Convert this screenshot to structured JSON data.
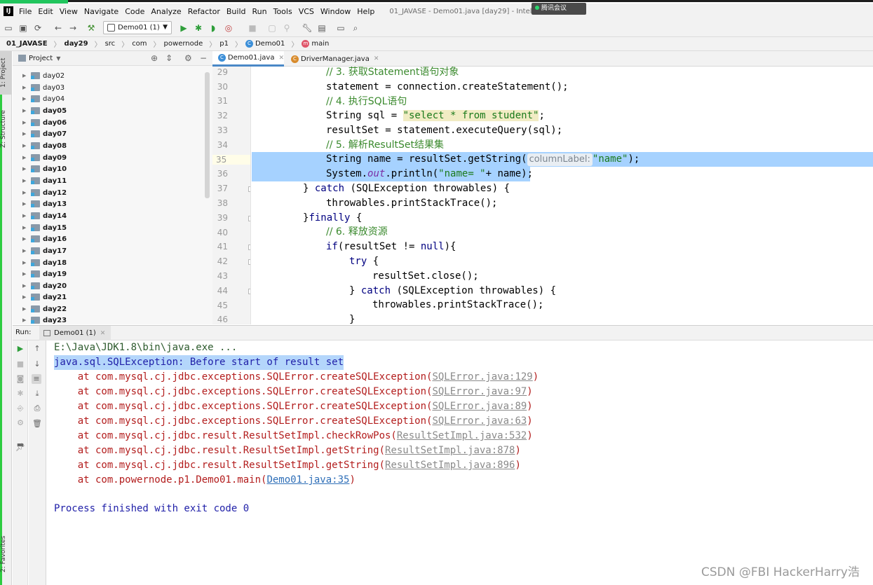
{
  "menubar": {
    "logo": "IJ",
    "items": [
      "File",
      "Edit",
      "View",
      "Navigate",
      "Code",
      "Analyze",
      "Refactor",
      "Build",
      "Run",
      "Tools",
      "VCS",
      "Window",
      "Help"
    ],
    "window_title": "01_JAVASE - Demo01.java [day29] - IntelliJ IDEA",
    "meeting_badge": "腾讯会议"
  },
  "toolbar": {
    "run_config": "Demo01 (1)"
  },
  "breadcrumb": [
    "01_JAVASE",
    "day29",
    "src",
    "com",
    "powernode",
    "p1",
    "Demo01",
    "main"
  ],
  "left_stripe": {
    "project_tab": "1: Project",
    "structure_tab": "Z: Structure",
    "favorites_tab": "2: Favorites"
  },
  "project_panel": {
    "title": "Project",
    "items": [
      {
        "label": "day02",
        "bold": false
      },
      {
        "label": "day03",
        "bold": false
      },
      {
        "label": "day04",
        "bold": false
      },
      {
        "label": "day05",
        "bold": true
      },
      {
        "label": "day06",
        "bold": true
      },
      {
        "label": "day07",
        "bold": true
      },
      {
        "label": "day08",
        "bold": true
      },
      {
        "label": "day09",
        "bold": true
      },
      {
        "label": "day10",
        "bold": true
      },
      {
        "label": "day11",
        "bold": true
      },
      {
        "label": "day12",
        "bold": true
      },
      {
        "label": "day13",
        "bold": true
      },
      {
        "label": "day14",
        "bold": true
      },
      {
        "label": "day15",
        "bold": true
      },
      {
        "label": "day16",
        "bold": true
      },
      {
        "label": "day17",
        "bold": true
      },
      {
        "label": "day18",
        "bold": true
      },
      {
        "label": "day19",
        "bold": true
      },
      {
        "label": "day20",
        "bold": true
      },
      {
        "label": "day21",
        "bold": true
      },
      {
        "label": "day22",
        "bold": true
      },
      {
        "label": "day23",
        "bold": true
      }
    ]
  },
  "editor": {
    "tabs": [
      {
        "label": "Demo01.java",
        "active": true
      },
      {
        "label": "DriverManager.java",
        "active": false
      }
    ],
    "line_numbers": [
      "29",
      "30",
      "31",
      "32",
      "33",
      "34",
      "35",
      "36",
      "37",
      "38",
      "39",
      "40",
      "41",
      "42",
      "43",
      "44",
      "45",
      "46"
    ],
    "lines": {
      "l29": "// 3. 获取Statement语句对象",
      "l30": "statement = connection.createStatement();",
      "l31": "// 4. 执行SQL语句",
      "l32a": "String sql = ",
      "l32b": "\"select * from student\"",
      "l32c": ";",
      "l33": "resultSet = statement.executeQuery(sql);",
      "l34": "// 5. 解析ResultSet结果集",
      "l35a": "String name = resultSet.getString(",
      "l35hint": "columnLabel:",
      "l35b": "\"name\"",
      "l35c": ");",
      "l36a": "System.",
      "l36b": "out",
      "l36c": ".println(",
      "l36d": "\"name= \"",
      "l36e": "+ name);",
      "l37a": "} ",
      "l37b": "catch",
      "l37c": " (SQLException throwables) {",
      "l38": "throwables.printStackTrace();",
      "l39a": "}",
      "l39b": "finally",
      "l39c": " {",
      "l40": "// 6. 释放资源",
      "l41a": "if",
      "l41b": "(resultSet != ",
      "l41c": "null",
      "l41d": "){",
      "l42a": "try",
      "l42b": " {",
      "l43": "resultSet.close();",
      "l44a": "} ",
      "l44b": "catch",
      "l44c": " (SQLException throwables) {",
      "l45": "throwables.printStackTrace();",
      "l46": "}"
    }
  },
  "run_panel": {
    "label": "Run:",
    "tab": "Demo01 (1)",
    "console": {
      "cmd": "E:\\Java\\JDK1.8\\bin\\java.exe ...",
      "exception": "java.sql.SQLException: Before start of result set",
      "stack": [
        {
          "text": "    at com.mysql.cj.jdbc.exceptions.SQLError.createSQLException(",
          "link": "SQLError.java:129",
          "end": ")"
        },
        {
          "text": "    at com.mysql.cj.jdbc.exceptions.SQLError.createSQLException(",
          "link": "SQLError.java:97",
          "end": ")"
        },
        {
          "text": "    at com.mysql.cj.jdbc.exceptions.SQLError.createSQLException(",
          "link": "SQLError.java:89",
          "end": ")"
        },
        {
          "text": "    at com.mysql.cj.jdbc.exceptions.SQLError.createSQLException(",
          "link": "SQLError.java:63",
          "end": ")"
        },
        {
          "text": "    at com.mysql.cj.jdbc.result.ResultSetImpl.checkRowPos(",
          "link": "ResultSetImpl.java:532",
          "end": ")"
        },
        {
          "text": "    at com.mysql.cj.jdbc.result.ResultSetImpl.getString(",
          "link": "ResultSetImpl.java:878",
          "end": ")"
        },
        {
          "text": "    at com.mysql.cj.jdbc.result.ResultSetImpl.getString(",
          "link": "ResultSetImpl.java:896",
          "end": ")"
        },
        {
          "text": "    at com.powernode.p1.Demo01.main(",
          "link": "Demo01.java:35",
          "end": ")"
        }
      ],
      "finish": "Process finished with exit code 0"
    }
  },
  "watermark": "CSDN @FBI HackerHarry浩"
}
